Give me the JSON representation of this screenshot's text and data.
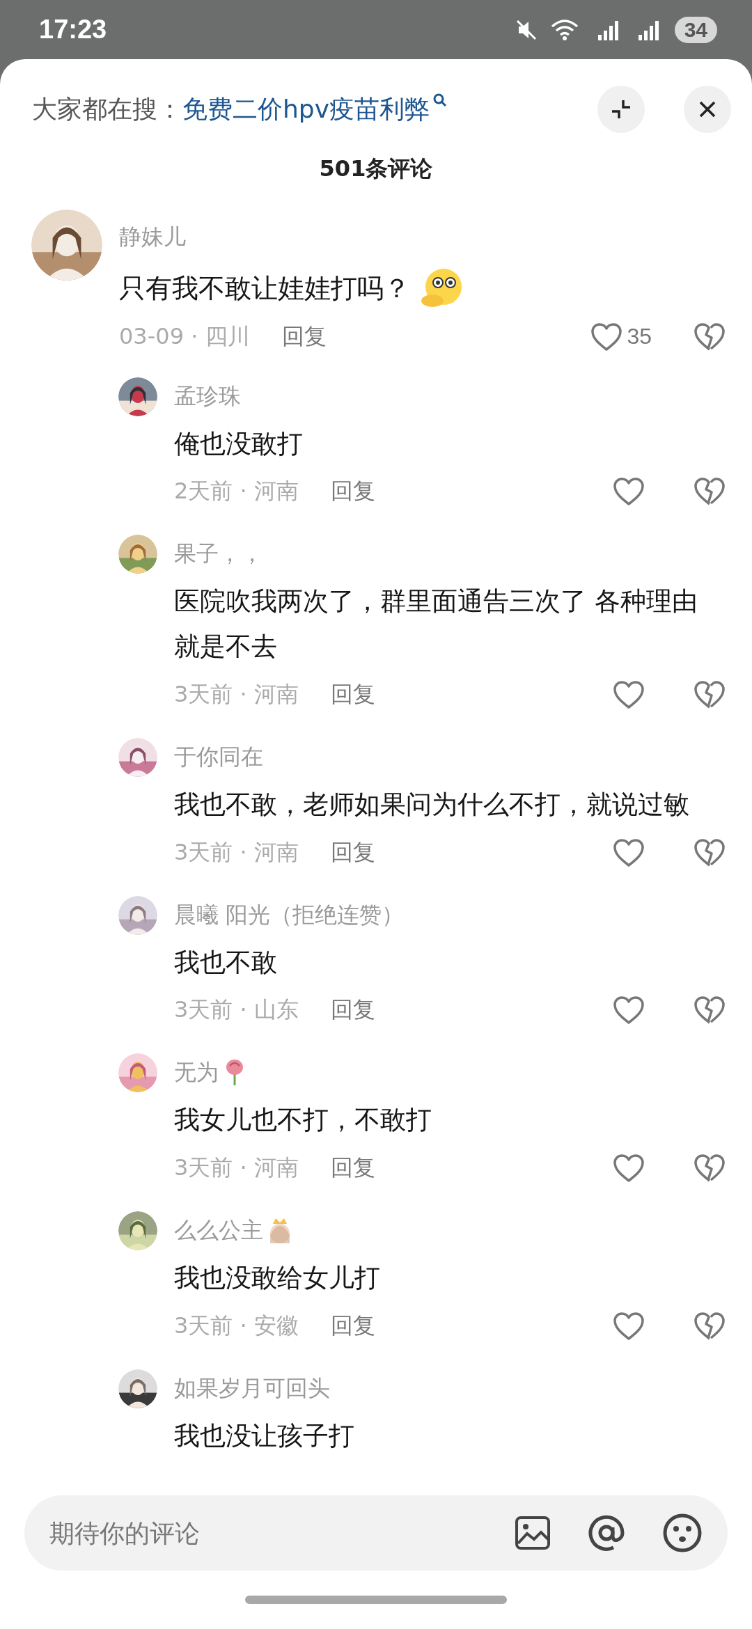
{
  "status_bar": {
    "time": "17:23",
    "battery": "34"
  },
  "search_hint": {
    "label": "大家都在搜：",
    "query": "免费二价hpv疫苗利弊"
  },
  "title": "501条评论",
  "comment": {
    "name": "静妹儿",
    "text": "只有我不敢让娃娃打吗？",
    "emoji": {
      "kind": "thinking"
    },
    "meta": "03-09 · 四川",
    "reply": "回复",
    "likes": "35",
    "replies": [
      {
        "name": "孟珍珠",
        "text": "俺也没敢打",
        "meta": "2天前 · 河南",
        "reply": "回复"
      },
      {
        "name": "果子，，",
        "text": "医院吹我两次了，群里面通告三次了  各种理由就是不去",
        "meta": "3天前 · 河南",
        "reply": "回复"
      },
      {
        "name": "于你同在",
        "text": "我也不敢，老师如果问为什么不打，就说过敏",
        "meta": "3天前 · 河南",
        "reply": "回复"
      },
      {
        "name": "晨曦 阳光（拒绝连赞）",
        "text": "我也不敢",
        "meta": "3天前 · 山东",
        "reply": "回复"
      },
      {
        "name": "无为",
        "emoji": {
          "kind": "rose"
        },
        "text": "我女儿也不打，不敢打",
        "meta": "3天前 · 河南",
        "reply": "回复"
      },
      {
        "name": "么么公主",
        "emoji": {
          "kind": "princess"
        },
        "text": "我也没敢给女儿打",
        "meta": "3天前 · 安徽",
        "reply": "回复"
      },
      {
        "name": "如果岁月可回头",
        "text": "我也没让孩子打"
      }
    ]
  },
  "input": {
    "placeholder": "期待你的评论"
  }
}
